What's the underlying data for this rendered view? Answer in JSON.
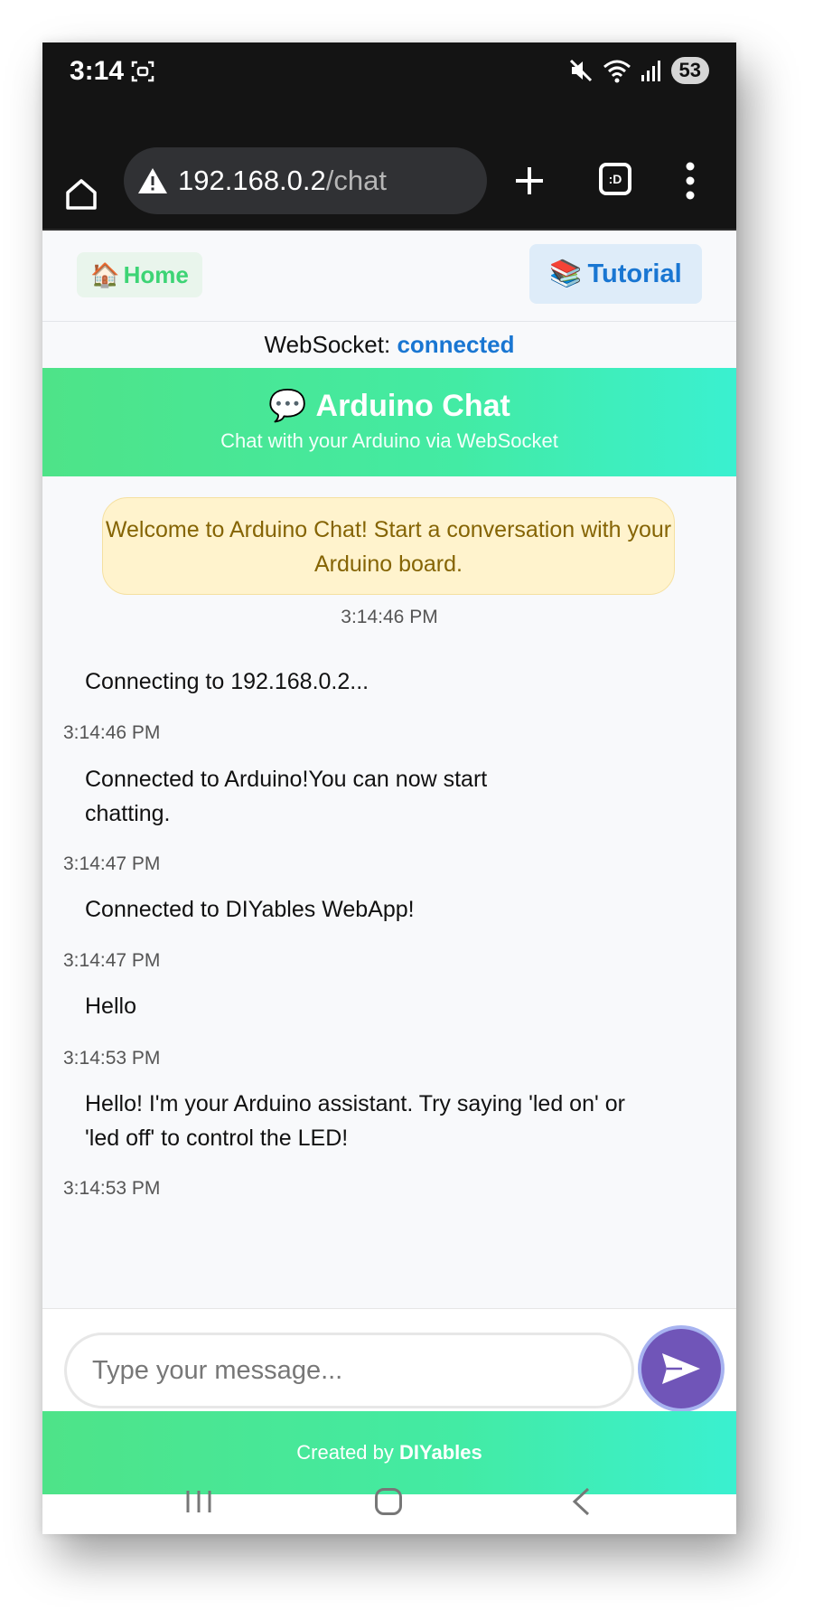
{
  "status_bar": {
    "time": "3:14",
    "battery": "53"
  },
  "browser": {
    "url_host": "192.168.0.2",
    "url_path": "/chat",
    "tabs_glyph": ":D"
  },
  "nav": {
    "home_emoji": "🏠",
    "home_label": "Home",
    "tutorial_emoji": "📚",
    "tutorial_label": "Tutorial"
  },
  "websocket": {
    "label": "WebSocket: ",
    "state": "connected"
  },
  "header": {
    "emoji": "💬",
    "title": "Arduino Chat",
    "subtitle": "Chat with your Arduino via WebSocket"
  },
  "chat": {
    "welcome": {
      "text": "Welcome to Arduino Chat! Start a conversation with your Arduino board.",
      "time": "3:14:46 PM"
    },
    "messages": [
      {
        "text": "Connecting to 192.168.0.2...",
        "time": "3:14:46 PM"
      },
      {
        "text": "Connected to Arduino!You can now start chatting.",
        "time": "3:14:47 PM"
      },
      {
        "text": "Connected to DIYables WebApp!",
        "time": "3:14:47 PM"
      },
      {
        "text": "Hello",
        "time": "3:14:53 PM"
      },
      {
        "text": "Hello! I'm your Arduino assistant. Try saying 'led on' or 'led off' to control the LED!",
        "time": "3:14:53 PM"
      }
    ]
  },
  "input": {
    "placeholder": "Type your message...",
    "value": ""
  },
  "footer": {
    "prefix": "Created by ",
    "brand": "DIYables"
  },
  "colors": {
    "accent_green": "#43eba4",
    "link_blue": "#1976d2",
    "send_purple": "#7055b8",
    "welcome_bg": "#fff3cd"
  }
}
